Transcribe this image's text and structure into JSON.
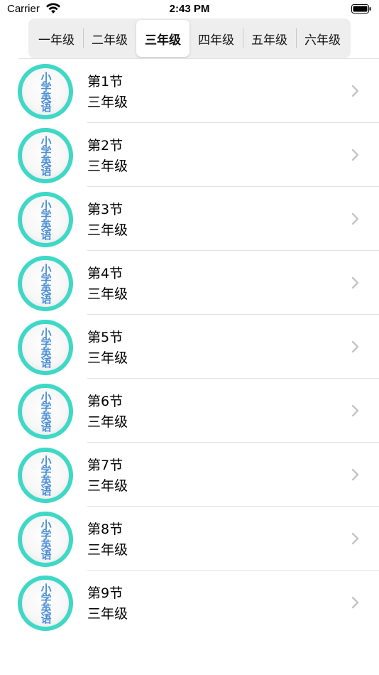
{
  "status_bar": {
    "carrier": "Carrier",
    "time": "2:43 PM",
    "icons": [
      "wifi-icon",
      "battery-icon"
    ]
  },
  "segments": {
    "selected_index": 2,
    "items": [
      "一年级",
      "二年级",
      "三年级",
      "四年级",
      "五年级",
      "六年级"
    ]
  },
  "lessons": [
    {
      "title": "第1节",
      "grade": "三年级",
      "avatar_text": "小学英语"
    },
    {
      "title": "第2节",
      "grade": "三年级",
      "avatar_text": "小学英语"
    },
    {
      "title": "第3节",
      "grade": "三年级",
      "avatar_text": "小学英语"
    },
    {
      "title": "第4节",
      "grade": "三年级",
      "avatar_text": "小学英语"
    },
    {
      "title": "第5节",
      "grade": "三年级",
      "avatar_text": "小学英语"
    },
    {
      "title": "第6节",
      "grade": "三年级",
      "avatar_text": "小学英语"
    },
    {
      "title": "第7节",
      "grade": "三年级",
      "avatar_text": "小学英语"
    },
    {
      "title": "第8节",
      "grade": "三年级",
      "avatar_text": "小学英语"
    },
    {
      "title": "第9节",
      "grade": "三年级",
      "avatar_text": "小学英语"
    }
  ],
  "colors": {
    "avatar_ring": "#3fd8c6",
    "avatar_text": "#4b8fd8",
    "chevron": "#c4c4c7"
  }
}
